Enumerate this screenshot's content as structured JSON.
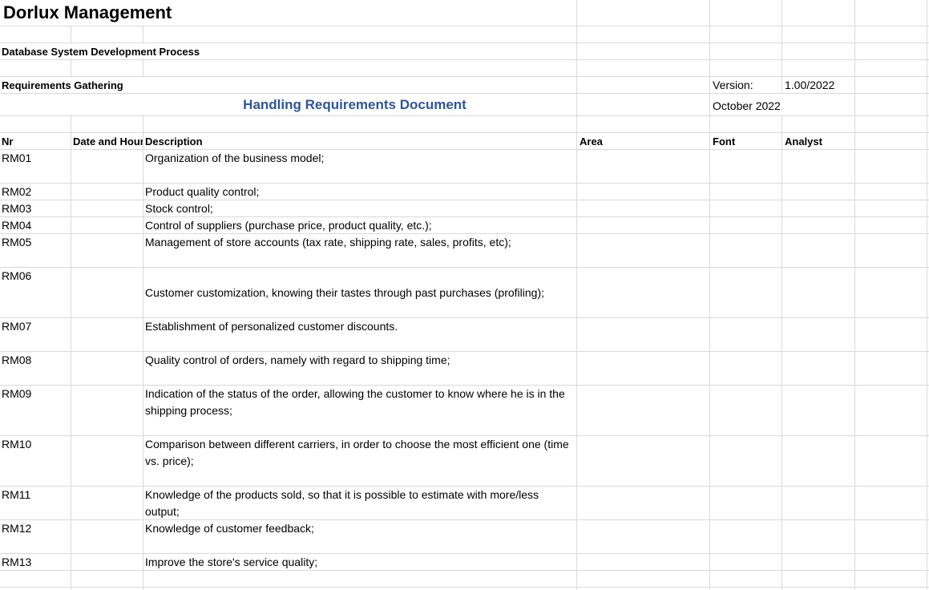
{
  "header": {
    "title": "Dorlux Management",
    "subtitle": "Database System Development Process",
    "phase": "Requirements Gathering",
    "doc_title": "Handling Requirements Document",
    "version_label": "Version:",
    "version_value": "1.00/2022",
    "date": "October 2022"
  },
  "columns": {
    "nr": "Nr",
    "date": "Date and Hour",
    "description": "Description",
    "area": "Area",
    "font": "Font",
    "analyst": "Analyst"
  },
  "rows": [
    {
      "nr": "RM01",
      "description": "Organization of the business model;"
    },
    {
      "nr": "RM02",
      "description": "Product quality control;"
    },
    {
      "nr": "RM03",
      "description": "Stock control;"
    },
    {
      "nr": "RM04",
      "description": "Control of suppliers (purchase price, product quality, etc.);"
    },
    {
      "nr": "RM05",
      "description": "Management of store accounts (tax rate, shipping rate, sales, profits, etc);"
    },
    {
      "nr": "RM06",
      "description": "Customer customization, knowing their tastes through past purchases (profiling);"
    },
    {
      "nr": "RM07",
      "description": "Establishment of personalized customer discounts."
    },
    {
      "nr": "RM08",
      "description": "Quality control of orders, namely with regard to shipping time;"
    },
    {
      "nr": "RM09",
      "description": "Indication of the status of the order, allowing the customer to know where he is in the shipping process;"
    },
    {
      "nr": "RM10",
      "description": "Comparison between different carriers, in order to choose the most efficient one (time vs. price);"
    },
    {
      "nr": "RM11",
      "description": "Knowledge of the products sold, so that it is possible to estimate with more/less output;"
    },
    {
      "nr": "RM12",
      "description": "Knowledge of customer feedback;"
    },
    {
      "nr": "RM13",
      "description": "Improve the store's service quality;"
    }
  ],
  "colors": {
    "gridline": "#d9d9d9",
    "doc_title": "#2f5597"
  }
}
